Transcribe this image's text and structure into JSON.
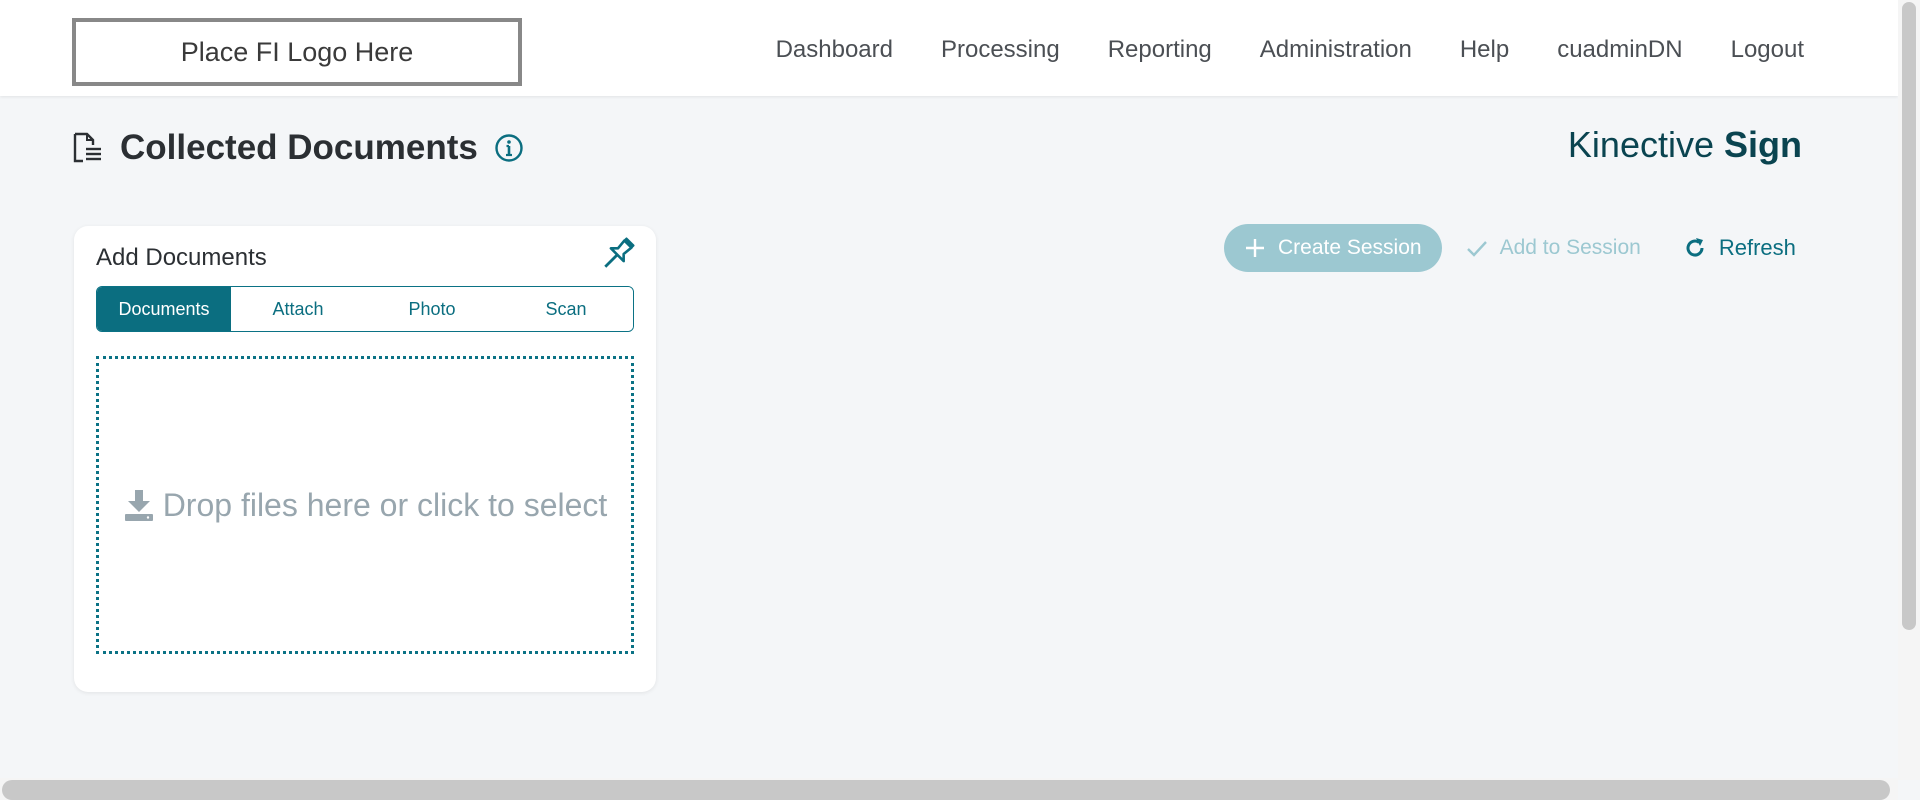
{
  "header": {
    "logo_text": "Place FI Logo Here",
    "nav": [
      "Dashboard",
      "Processing",
      "Reporting",
      "Administration",
      "Help",
      "cuadminDN",
      "Logout"
    ]
  },
  "page": {
    "title": "Collected Documents",
    "brand_light": "Kinective ",
    "brand_bold": "Sign"
  },
  "add_documents": {
    "title": "Add Documents",
    "tabs": [
      "Documents",
      "Attach",
      "Photo",
      "Scan"
    ],
    "active_tab": "Documents",
    "dropzone_text": "Drop files here or click to select"
  },
  "actions": {
    "create_session": "Create Session",
    "add_to_session": "Add to Session",
    "refresh": "Refresh"
  },
  "colors": {
    "accent": "#0b6e80",
    "accent_disabled": "#9cc8d1",
    "background": "#f4f6f8"
  },
  "icons": [
    "document-icon",
    "info-icon",
    "pin-icon",
    "download-icon",
    "plus-icon",
    "check-icon",
    "refresh-icon"
  ]
}
